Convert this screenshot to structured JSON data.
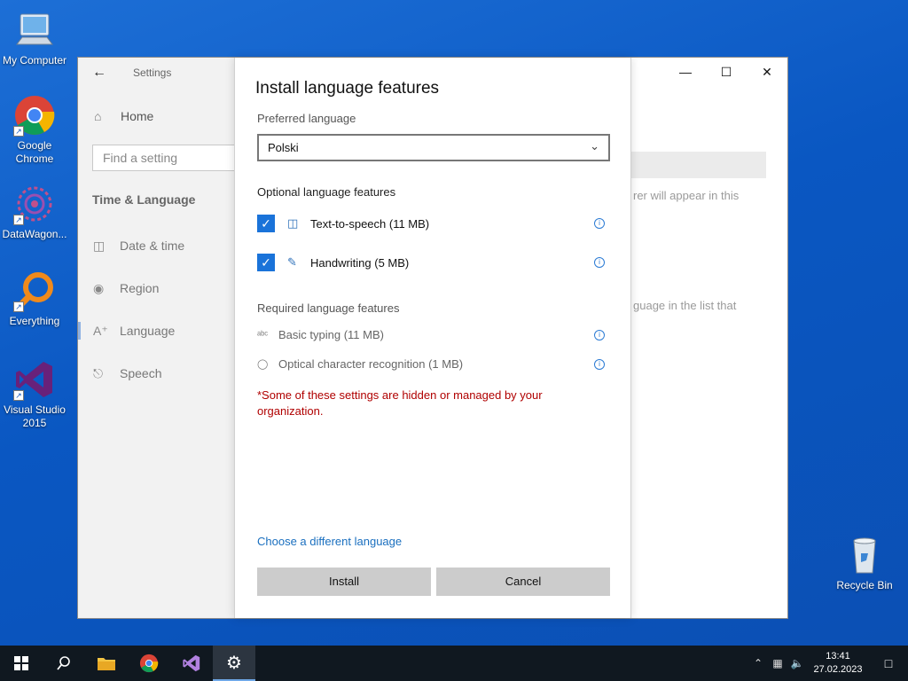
{
  "desktop": {
    "icons": [
      {
        "label": "My Computer"
      },
      {
        "label": "Google Chrome"
      },
      {
        "label": "DataWagon..."
      },
      {
        "label": "Everything"
      },
      {
        "label": "Visual Studio 2015"
      },
      {
        "label": "Recycle Bin"
      }
    ]
  },
  "settings": {
    "title": "Settings",
    "home": "Home",
    "search_placeholder": "Find a setting",
    "section": "Time & Language",
    "items": [
      {
        "label": "Date & time",
        "icon": "calendar-icon"
      },
      {
        "label": "Region",
        "icon": "globe-icon"
      },
      {
        "label": "Language",
        "icon": "language-icon"
      },
      {
        "label": "Speech",
        "icon": "microphone-icon"
      }
    ],
    "background_text_1": "rer will appear in this",
    "background_text_2": "guage in the list that"
  },
  "dialog": {
    "title": "Install language features",
    "preferred_label": "Preferred language",
    "preferred_value": "Polski",
    "optional_heading": "Optional language features",
    "optional": [
      {
        "label": "Text-to-speech (11 MB)",
        "checked": true
      },
      {
        "label": "Handwriting (5 MB)",
        "checked": true
      }
    ],
    "required_heading": "Required language features",
    "required": [
      {
        "label": "Basic typing (11 MB)"
      },
      {
        "label": "Optical character recognition (1 MB)"
      }
    ],
    "notice": "*Some of these settings are hidden or managed by your organization.",
    "link": "Choose a different language",
    "install_label": "Install",
    "cancel_label": "Cancel"
  },
  "taskbar": {
    "time": "13:41",
    "date": "27.02.2023"
  },
  "colors": {
    "accent": "#1a73d9",
    "notice": "#b00000",
    "link": "#1a6fbf"
  }
}
